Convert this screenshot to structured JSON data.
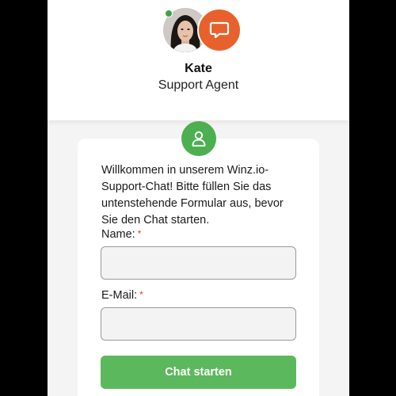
{
  "agent": {
    "name": "Kate",
    "role": "Support Agent"
  },
  "form": {
    "intro": "Willkommen in unserem Winz.io-Support-Chat! Bitte füllen Sie das untenstehende Formular aus, bevor Sie den Chat starten.",
    "name_label": "Name:",
    "email_label": "E-Mail:",
    "required_marker": "*",
    "name_value": "",
    "email_value": "",
    "submit_label": "Chat starten"
  },
  "colors": {
    "accent_green": "#5cb85c",
    "chat_badge_orange": "#e8612d",
    "required_red": "#e53935"
  },
  "icons": {
    "chat_badge": "chat-bubble-icon",
    "user": "user-icon",
    "online": "online-status-dot"
  }
}
